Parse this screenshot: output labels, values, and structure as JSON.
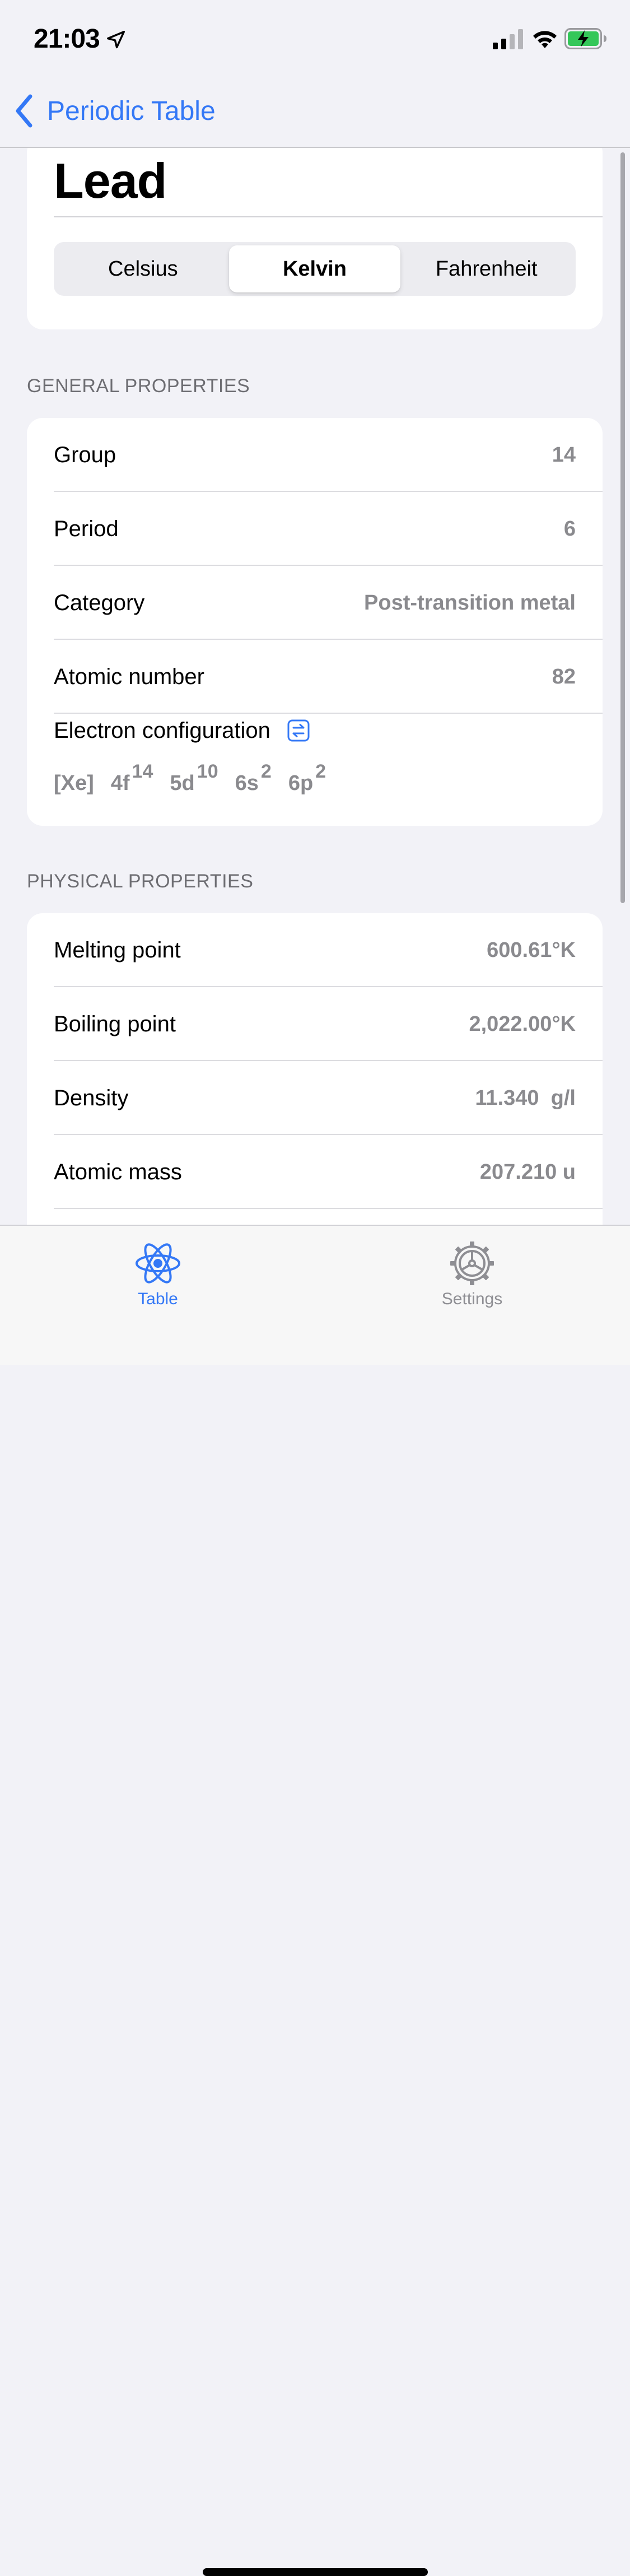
{
  "status_bar": {
    "time": "21:03",
    "icons": [
      "location-arrow-icon",
      "cellular-signal-icon",
      "wifi-icon",
      "battery-charging-icon"
    ]
  },
  "nav": {
    "back_label": "Periodic Table",
    "back_icon": "chevron-left-icon"
  },
  "element": {
    "name": "Lead"
  },
  "temperature_units": {
    "options": [
      "Celsius",
      "Kelvin",
      "Fahrenheit"
    ],
    "selected": "Kelvin"
  },
  "general": {
    "header": "GENERAL PROPERTIES",
    "rows": [
      {
        "label": "Group",
        "value": "14"
      },
      {
        "label": "Period",
        "value": "6"
      },
      {
        "label": "Category",
        "value": "Post-transition metal"
      },
      {
        "label": "Atomic number",
        "value": "82"
      }
    ],
    "electron_configuration": {
      "label": "Electron configuration",
      "icon": "swap-arrows-icon",
      "core": "[Xe]",
      "orbitals": [
        {
          "name": "4f",
          "electrons": "14"
        },
        {
          "name": "5d",
          "electrons": "10"
        },
        {
          "name": "6s",
          "electrons": "2"
        },
        {
          "name": "6p",
          "electrons": "2"
        }
      ]
    }
  },
  "physical": {
    "header": "PHYSICAL PROPERTIES",
    "rows": [
      {
        "label": "Melting point",
        "value": "600.61°K"
      },
      {
        "label": "Boiling point",
        "value": "2,022.00°K"
      },
      {
        "label": "Density",
        "value": "11.340  g/l"
      },
      {
        "label": "Atomic mass",
        "value": "207.210 u"
      }
    ]
  },
  "tab_bar": {
    "tabs": [
      {
        "label": "Table",
        "icon": "atom-icon",
        "selected": true
      },
      {
        "label": "Settings",
        "icon": "gear-icon",
        "selected": false
      }
    ]
  },
  "colors": {
    "accent": "#3478f6",
    "background": "#f2f2f7",
    "secondary_text": "#8a8a8e",
    "battery_green": "#34c759"
  }
}
